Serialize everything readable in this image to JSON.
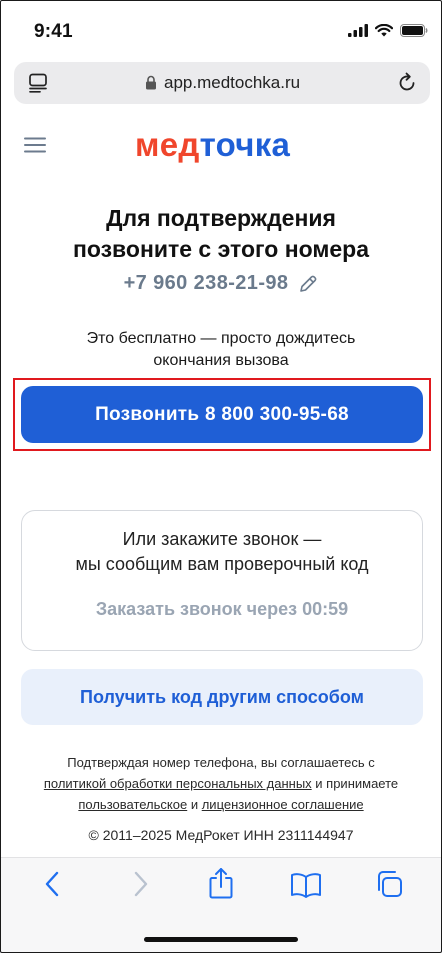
{
  "status_bar": {
    "time": "9:41"
  },
  "browser": {
    "url": "app.medtochka.ru"
  },
  "header": {
    "logo_part1": "мед",
    "logo_part2": "точка",
    "brand_colors": {
      "red": "#f0462c",
      "blue": "#1f5fd6"
    }
  },
  "main": {
    "title_line1": "Для подтверждения",
    "title_line2": "позвоните с этого номера",
    "phone_number": "+7 960 238-21-98",
    "hint_line1": "Это бесплатно — просто дождитесь",
    "hint_line2": "окончания вызова",
    "call_button_label": "Позвонить 8 800 300-95-68",
    "request_card": {
      "line1": "Или закажите звонок —",
      "line2": "мы сообщим вам проверочный код",
      "timer_label": "Заказать звонок через 00:59"
    },
    "alt_button_label": "Получить код другим способом"
  },
  "legal": {
    "text1": "Подтверждая номер телефона, вы соглашаетесь с",
    "link1": "политикой обработки персональных данных",
    "text2": " и принимаете",
    "link2": "пользовательское",
    "text3": " и ",
    "link3": "лицензионное соглашение",
    "copyright": "© 2011–2025 МедРокет ИНН 2311144947"
  },
  "toolbar": {
    "icons": [
      "back-icon",
      "forward-icon",
      "share-icon",
      "bookmarks-icon",
      "tabs-icon"
    ]
  }
}
